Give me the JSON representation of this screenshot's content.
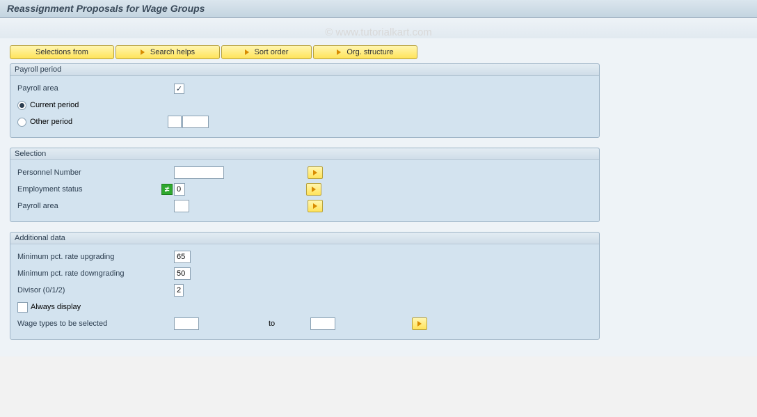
{
  "title": "Reassignment Proposals for Wage Groups",
  "watermark": "© www.tutorialkart.com",
  "toolbar": {
    "selections_from": "Selections from",
    "search_helps": "Search helps",
    "sort_order": "Sort order",
    "org_structure": "Org. structure"
  },
  "payroll_period": {
    "group_title": "Payroll period",
    "payroll_area_label": "Payroll area",
    "payroll_area_checked": true,
    "current_period_label": "Current period",
    "other_period_label": "Other period",
    "period_selected": "current",
    "other_period_from": "",
    "other_period_to": ""
  },
  "selection": {
    "group_title": "Selection",
    "personnel_number_label": "Personnel Number",
    "personnel_number_value": "",
    "employment_status_label": "Employment status",
    "employment_status_value": "0",
    "payroll_area_label": "Payroll area",
    "payroll_area_value": ""
  },
  "additional_data": {
    "group_title": "Additional data",
    "min_pct_upgrade_label": "Minimum pct. rate upgrading",
    "min_pct_upgrade_value": "65",
    "min_pct_downgrade_label": "Minimum pct. rate downgrading",
    "min_pct_downgrade_value": "50",
    "divisor_label": "Divisor (0/1/2)",
    "divisor_value": "2",
    "always_display_label": "Always display",
    "always_display_checked": false,
    "wage_types_label": "Wage types to be selected",
    "wage_types_from": "",
    "to_label": "to",
    "wage_types_to": ""
  }
}
